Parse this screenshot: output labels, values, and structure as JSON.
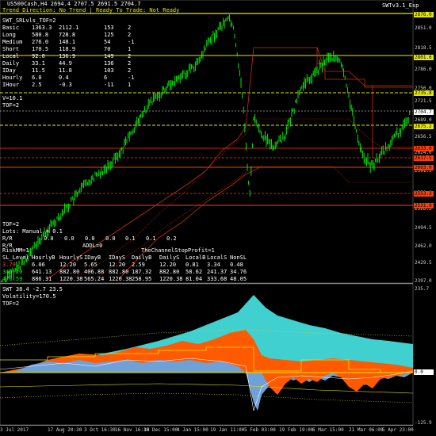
{
  "header": {
    "title": "　US500Cash,H4 2694.4 2707.5 2691.5 2704.7",
    "swt_version": "SWTv3.1_Esp",
    "status": "Trend Direction: No Trend | Ready To Trade: Not Ready"
  },
  "table1": {
    "title": "SWT_SRLvls_TOF=2",
    "rows": [
      [
        "Basic",
        "1363.3",
        "2112.1",
        "153",
        "2"
      ],
      [
        "Long",
        "580.8",
        "728.8",
        "125",
        "2"
      ],
      [
        "Medium",
        "276.0",
        "148.1",
        "54",
        "-1"
      ],
      [
        "Short",
        "170.5",
        "118.9",
        "70",
        "1"
      ],
      [
        "Local",
        "92.0",
        "136.9",
        "149",
        "2"
      ],
      [
        "Daily",
        "33.1",
        "44.9",
        "136",
        "2"
      ],
      [
        "IDay",
        "11.5",
        "11.8",
        "103",
        "2"
      ],
      [
        "Hourly",
        "6.0",
        "0.4",
        "6",
        "-1"
      ],
      [
        "IHour",
        "2.5",
        "-0.3",
        "-11",
        "1"
      ]
    ],
    "v_line": "V=10.1",
    "tof_line": "TOF=2"
  },
  "table2": {
    "tof": "TOF=2",
    "lots": "Lots: Manual = 0.1",
    "rr_label": "R/R",
    "rr_values": [
      "0.0",
      "0.0",
      "0.0",
      "0.0",
      "0.1",
      "0.1",
      "0.2"
    ],
    "rr_line2": "R/R",
    "addl": "ADDL=0",
    "stop": "TheChannelStopProfit=1",
    "risk": "RiskMM=1",
    "sl_headers": [
      "SL_Level",
      "HourlyB",
      "HourlyS",
      "IDayB",
      "IDayS",
      "DailyB",
      "DailyS",
      "LocalB",
      "LocalS",
      "NonSL"
    ],
    "sl_rows": [
      {
        "color": "#ff4040",
        "values": [
          "3.79",
          "6.06",
          "12.20",
          "5.65",
          "12.20",
          "2.59",
          "12.20",
          "0.81",
          "3.34",
          "0.48"
        ]
      },
      {
        "color": "#00ff00",
        "values": [
          "346.20",
          "641.13",
          "882.80",
          "406.88",
          "882.80",
          "187.32",
          "882.80",
          "58.62",
          "241.37",
          "34.76"
        ]
      },
      {
        "color": "#00ff00",
        "values": [
          "478.59",
          "886.31",
          "1220.38",
          "565.24",
          "1220.38",
          "258.95",
          "1220.38",
          "81.04",
          "333.68",
          "48.05"
        ]
      }
    ]
  },
  "price_axis": {
    "labels": [
      "2876.0",
      "2851.0",
      "2818.5",
      "2786.0",
      "2756.0",
      "2721.5",
      "2689.0",
      "2656.5",
      "2624.0",
      "2591.5",
      "2559.0",
      "2526.5",
      "2494.5",
      "2462.0",
      "2429.5",
      "2397.0"
    ],
    "tags": [
      {
        "text": "2876.0",
        "bg": "#e6e600",
        "fg": "#000"
      },
      {
        "text": "2801.6",
        "bg": "#e6e600",
        "fg": "#000"
      },
      {
        "text": "2735.8",
        "bg": "#e6e600",
        "fg": "#000"
      },
      {
        "text": "2704.7",
        "bg": "#ffffff",
        "fg": "#000"
      },
      {
        "text": "2675.2",
        "bg": "#e6e600",
        "fg": "#000"
      },
      {
        "text": "2633.0",
        "bg": "#ff3d00",
        "fg": "#000"
      },
      {
        "text": "2617.5",
        "bg": "#ff3d00",
        "fg": "#000"
      },
      {
        "text": "2603.0",
        "bg": "#ff3d00",
        "fg": "#000"
      },
      {
        "text": "2553.3",
        "bg": "#ff3d00",
        "fg": "#000"
      },
      {
        "text": "2531.9",
        "bg": "#ff3d00",
        "fg": "#000"
      }
    ]
  },
  "sub_panel": {
    "line1": "SWT 38.4 -2.7 23.5",
    "line2": "Volatility=170.5",
    "line3": "TOF=2",
    "axis_top": "235.7",
    "axis_zero": "0.0",
    "axis_bottom": "-125.9"
  },
  "time_axis": [
    "3 Jul 2017",
    "17 Aug 20:30",
    "3 Oct 16:30",
    "16 Nov 16:30",
    "18 Dec 15:00",
    "4 Jan 15:00",
    "19 Jan 11:00",
    "5 Feb 03:00",
    "19 Feb 19:00",
    "6 Mar 15:00",
    "21 Mar 06:00",
    "5 Apr 23:00"
  ],
  "colors": {
    "candles": "#00ff00",
    "resistance": "#e6e600",
    "support": "#ff3d00",
    "cyan_area": "#40d0d0",
    "orange_area": "#ff5a00",
    "blue_area": "#6fa0d8"
  }
}
